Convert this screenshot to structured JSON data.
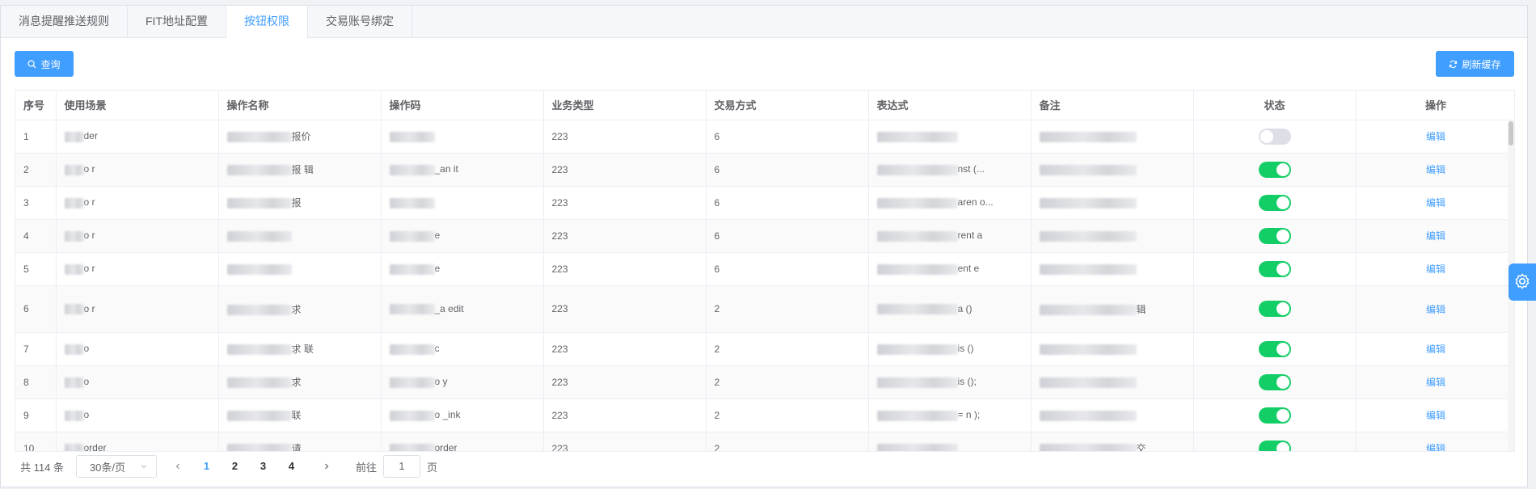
{
  "tabs": [
    {
      "label": "消息提醒推送规则"
    },
    {
      "label": "FIT地址配置"
    },
    {
      "label": "按钮权限"
    },
    {
      "label": "交易账号绑定"
    }
  ],
  "toolbar": {
    "query_label": "查询",
    "refresh_label": "刷新缓存"
  },
  "table": {
    "headers": [
      "序号",
      "使用场景",
      "操作名称",
      "操作码",
      "业务类型",
      "交易方式",
      "表达式",
      "备注",
      "状态",
      "操作"
    ],
    "rows": [
      {
        "index": "1",
        "scene": "der",
        "name": "报价",
        "code": "",
        "biz": "223",
        "mode": "6",
        "expr": "",
        "note": "",
        "status": "off",
        "action": "编辑"
      },
      {
        "index": "2",
        "scene": "o  r",
        "name": "报   辑",
        "code": "_an   it",
        "biz": "223",
        "mode": "6",
        "expr": "nst      (...",
        "note": "",
        "status": "on",
        "action": "编辑"
      },
      {
        "index": "3",
        "scene": "o  r",
        "name": "报",
        "code": "",
        "biz": "223",
        "mode": "6",
        "expr": "aren      o...",
        "note": "",
        "status": "on",
        "action": "编辑"
      },
      {
        "index": "4",
        "scene": "o  r",
        "name": "",
        "code": "e",
        "biz": "223",
        "mode": "6",
        "expr": "rent  a",
        "note": "",
        "status": "on",
        "action": "编辑"
      },
      {
        "index": "5",
        "scene": "o  r",
        "name": "",
        "code": "e",
        "biz": "223",
        "mode": "6",
        "expr": "ent  e",
        "note": "",
        "status": "on",
        "action": "编辑"
      },
      {
        "index": "6",
        "scene": "o  r",
        "name": "求",
        "code": "_a  edit",
        "biz": "223",
        "mode": "2",
        "expr": "a   ()",
        "note": "辑",
        "status": "on",
        "action": "编辑"
      },
      {
        "index": "7",
        "scene": "o",
        "name": "求   联",
        "code": "c",
        "biz": "223",
        "mode": "2",
        "expr": "is   ()",
        "note": "",
        "status": "on",
        "action": "编辑"
      },
      {
        "index": "8",
        "scene": "o",
        "name": "求",
        "code": "o   y",
        "biz": "223",
        "mode": "2",
        "expr": "is   ();",
        "note": "",
        "status": "on",
        "action": "编辑"
      },
      {
        "index": "9",
        "scene": "o",
        "name": "联",
        "code": "o  _ink",
        "biz": "223",
        "mode": "2",
        "expr": "= n   );",
        "note": "",
        "status": "on",
        "action": "编辑"
      },
      {
        "index": "10",
        "scene": "order",
        "name": "请",
        "code": "order",
        "biz": "223",
        "mode": "2",
        "expr": "",
        "note": "交",
        "status": "on",
        "action": "编辑"
      }
    ]
  },
  "pagination": {
    "total_text": "共 114 条",
    "page_size": "30条/页",
    "pages": [
      "1",
      "2",
      "3",
      "4"
    ],
    "current_page": "1",
    "goto_label": "前往",
    "goto_value": "1",
    "page_suffix": "页"
  },
  "colors": {
    "primary": "#409eff",
    "switch_on": "#13ce66",
    "switch_off": "#dcdfe6"
  },
  "icons": {
    "query": "search-icon",
    "refresh": "refresh-icon",
    "side": "gear-icon"
  }
}
